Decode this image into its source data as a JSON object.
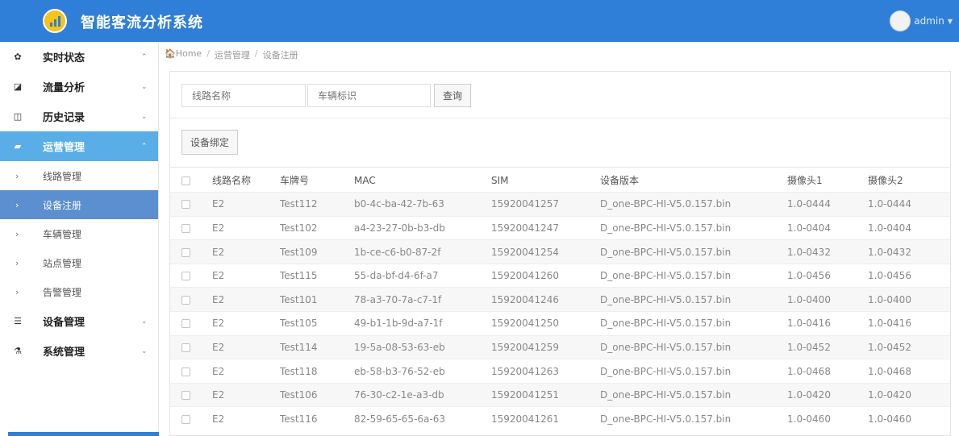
{
  "app": {
    "title": "智能客流分析系统",
    "user": "admin"
  },
  "sidebar": {
    "items": [
      {
        "name": "menu-realtime",
        "icon": "dashboard-icon",
        "glyph": "✿",
        "label": "实时状态",
        "chevron": "⌃"
      },
      {
        "name": "menu-flow",
        "icon": "edit-icon",
        "glyph": "◪",
        "label": "流量分析",
        "chevron": "⌄"
      },
      {
        "name": "menu-history",
        "icon": "book-icon",
        "glyph": "◫",
        "label": "历史记录",
        "chevron": "⌄"
      },
      {
        "name": "menu-ops",
        "icon": "notebook-icon",
        "glyph": "▰",
        "label": "运营管理",
        "chevron": "⌃",
        "active": true
      }
    ],
    "sub_items": [
      {
        "label": "线路管理"
      },
      {
        "label": "设备注册",
        "current": true
      },
      {
        "label": "车辆管理"
      },
      {
        "label": "站点管理"
      },
      {
        "label": "告警管理"
      }
    ],
    "items_after": [
      {
        "name": "menu-device",
        "icon": "list-icon",
        "glyph": "☰",
        "label": "设备管理",
        "chevron": "⌄"
      },
      {
        "name": "menu-system",
        "icon": "flask-icon",
        "glyph": "⚗",
        "label": "系统管理",
        "chevron": "⌄"
      }
    ]
  },
  "breadcrumb": {
    "home": "Home",
    "level1": "运营管理",
    "level2": "设备注册"
  },
  "search": {
    "route_placeholder": "线路名称",
    "vehicle_placeholder": "车辆标识",
    "query_label": "查询"
  },
  "toolbar": {
    "bind_label": "设备绑定"
  },
  "table": {
    "headers": [
      "线路名称",
      "车牌号",
      "MAC",
      "SIM",
      "设备版本",
      "摄像头1",
      "摄像头2"
    ],
    "rows": [
      [
        "E2",
        "Test112",
        "b0-4c-ba-42-7b-63",
        "15920041257",
        "D_one-BPC-HI-V5.0.157.bin",
        "1.0-0444",
        "1.0-0444"
      ],
      [
        "E2",
        "Test102",
        "a4-23-27-0b-b3-db",
        "15920041247",
        "D_one-BPC-HI-V5.0.157.bin",
        "1.0-0404",
        "1.0-0404"
      ],
      [
        "E2",
        "Test109",
        "1b-ce-c6-b0-87-2f",
        "15920041254",
        "D_one-BPC-HI-V5.0.157.bin",
        "1.0-0432",
        "1.0-0432"
      ],
      [
        "E2",
        "Test115",
        "55-da-bf-d4-6f-a7",
        "15920041260",
        "D_one-BPC-HI-V5.0.157.bin",
        "1.0-0456",
        "1.0-0456"
      ],
      [
        "E2",
        "Test101",
        "78-a3-70-7a-c7-1f",
        "15920041246",
        "D_one-BPC-HI-V5.0.157.bin",
        "1.0-0400",
        "1.0-0400"
      ],
      [
        "E2",
        "Test105",
        "49-b1-1b-9d-a7-1f",
        "15920041250",
        "D_one-BPC-HI-V5.0.157.bin",
        "1.0-0416",
        "1.0-0416"
      ],
      [
        "E2",
        "Test114",
        "19-5a-08-53-63-eb",
        "15920041259",
        "D_one-BPC-HI-V5.0.157.bin",
        "1.0-0452",
        "1.0-0452"
      ],
      [
        "E2",
        "Test118",
        "eb-58-b3-76-52-eb",
        "15920041263",
        "D_one-BPC-HI-V5.0.157.bin",
        "1.0-0468",
        "1.0-0468"
      ],
      [
        "E2",
        "Test106",
        "76-30-c2-1e-a3-db",
        "15920041251",
        "D_one-BPC-HI-V5.0.157.bin",
        "1.0-0420",
        "1.0-0420"
      ],
      [
        "E2",
        "Test116",
        "82-59-65-65-6a-63",
        "15920041261",
        "D_one-BPC-HI-V5.0.157.bin",
        "1.0-0460",
        "1.0-0460"
      ]
    ]
  },
  "colors": {
    "header": "#2f7fd8",
    "active_menu": "#5aaee8",
    "current_sub": "#5c8fd0",
    "logo": "#f6c31a"
  }
}
